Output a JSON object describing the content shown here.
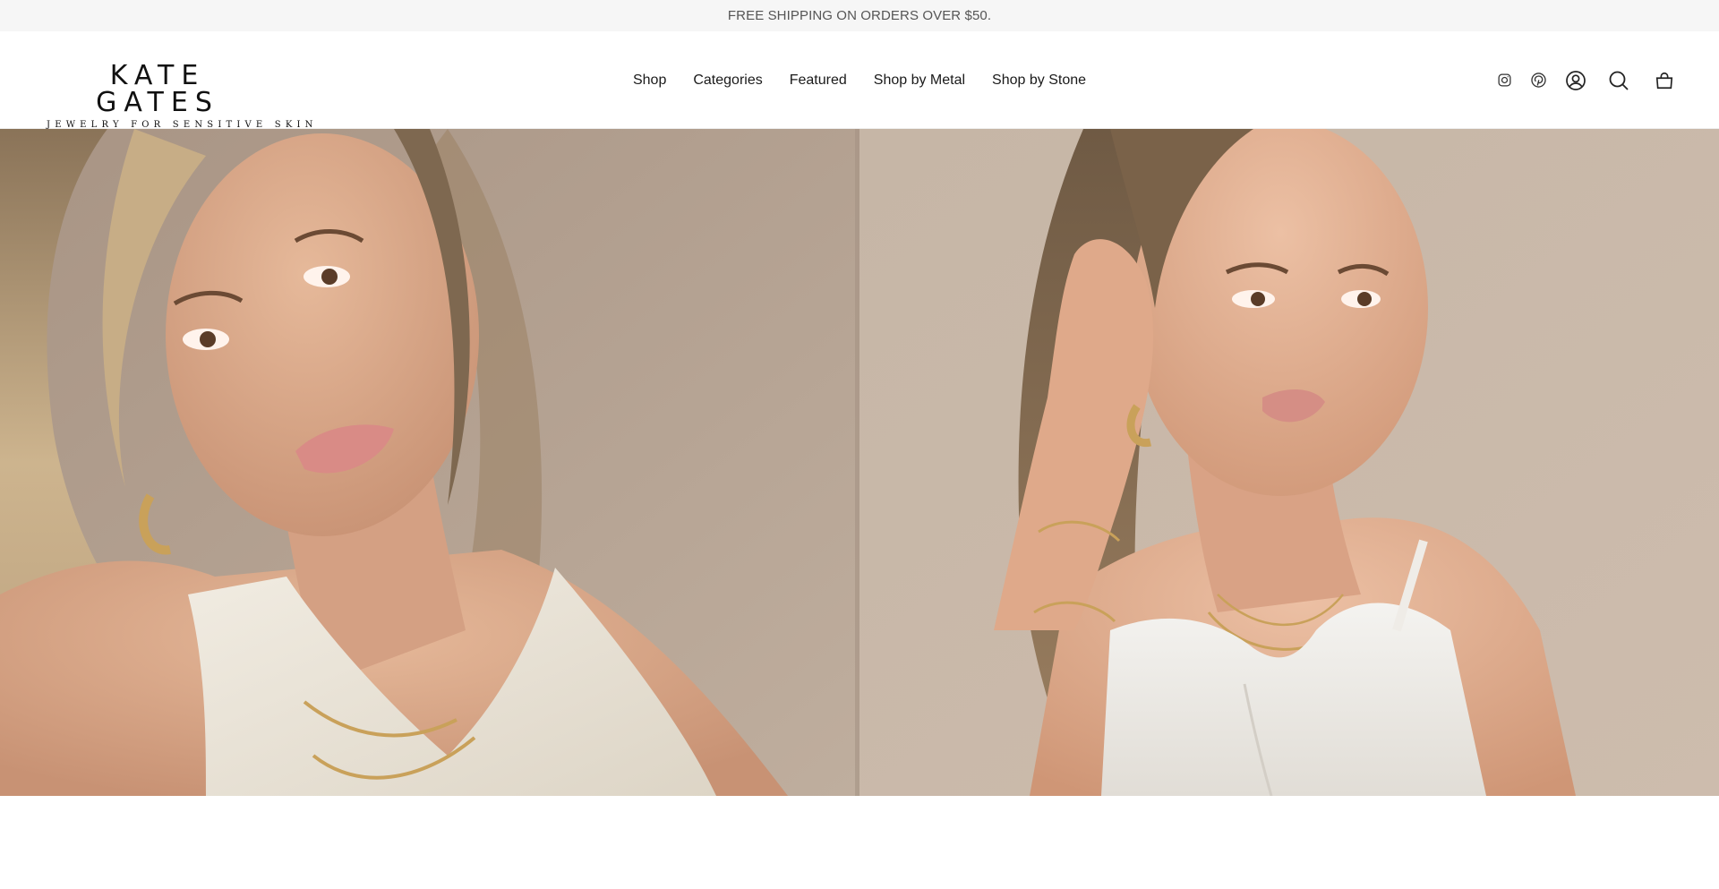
{
  "announcement": {
    "text": "FREE SHIPPING ON ORDERS OVER $50."
  },
  "logo": {
    "title": "KATE GATES",
    "tagline": "JEWELRY FOR SENSITIVE SKIN"
  },
  "nav": {
    "items": [
      {
        "label": "Shop"
      },
      {
        "label": "Categories"
      },
      {
        "label": "Featured"
      },
      {
        "label": "Shop by Metal"
      },
      {
        "label": "Shop by Stone"
      }
    ]
  },
  "header_icons": [
    {
      "name": "instagram-icon"
    },
    {
      "name": "pinterest-icon"
    },
    {
      "name": "account-icon"
    },
    {
      "name": "search-icon"
    },
    {
      "name": "cart-icon"
    }
  ],
  "hero": {
    "images": [
      {
        "name": "model-halter-top-gold-necklaces",
        "background": "#b4a393"
      },
      {
        "name": "model-white-top-gold-earrings",
        "background": "#c4b4a4"
      }
    ]
  },
  "colors": {
    "announcement_bg": "#f6f6f6",
    "text": "#1a1a1a",
    "skin": "#d9a98a",
    "gold": "#c9a15a",
    "fabric": "#eee8dc"
  }
}
